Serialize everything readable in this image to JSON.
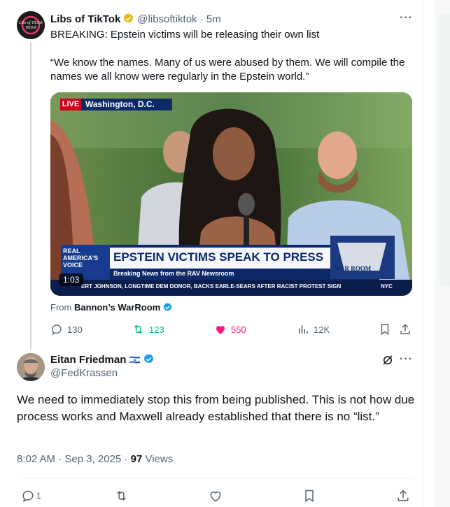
{
  "quoted": {
    "display_name": "Libs of TikTok",
    "handle": "@libsoftiktok",
    "time": "· 5m",
    "text_line1": "BREAKING: Epstein victims will be releasing their own list",
    "text_line2": "“We know the names. Many of us were abused by them. We will compile the names we all know were regularly in the Epstein world.”",
    "avatar_text": "Libs of TikTok",
    "video": {
      "live_badge": "LIVE",
      "location": "Washington, D.C.",
      "channel_logo": "REAL AMERICA'S VOICE",
      "headline": "EPSTEIN VICTIMS SPEAK TO PRESS",
      "subheadline": "Breaking News from the RAV Newsroom",
      "ticker": "ERT JOHNSON, LONGTIME DEM DONOR, BACKS EARLE-SEARS AFTER RACIST PROTEST SIGN",
      "ticker_city": "NYC",
      "brand": "WAR ROOM",
      "duration": "1:03"
    },
    "from_label": "From",
    "from_source": "Bannon’s WarRoom",
    "stats": {
      "replies": "130",
      "reposts": "123",
      "likes": "550",
      "views": "12K"
    }
  },
  "reply": {
    "display_name": "Eitan Friedman",
    "flag": "🇮🇱",
    "handle": "@FedKrassen",
    "text": "We need to immediately stop this from being published. This is not how due process works and Maxwell already established that there is no “list.”",
    "timestamp": "8:02 AM · Sep 3, 2025 · ",
    "views_count": "97",
    "views_label": " Views",
    "reply_count": "1"
  },
  "colors": {
    "verified_blue": "#1d9bf0",
    "verified_gold": "#e2b719",
    "repost_green": "#00ba7c",
    "like_pink": "#f91880",
    "muted": "#536471"
  },
  "icons": [
    "verified-gold-icon",
    "verified-blue-icon",
    "more-icon",
    "reply-icon",
    "repost-icon",
    "heart-icon",
    "views-icon",
    "bookmark-icon",
    "share-icon",
    "grok-icon"
  ]
}
